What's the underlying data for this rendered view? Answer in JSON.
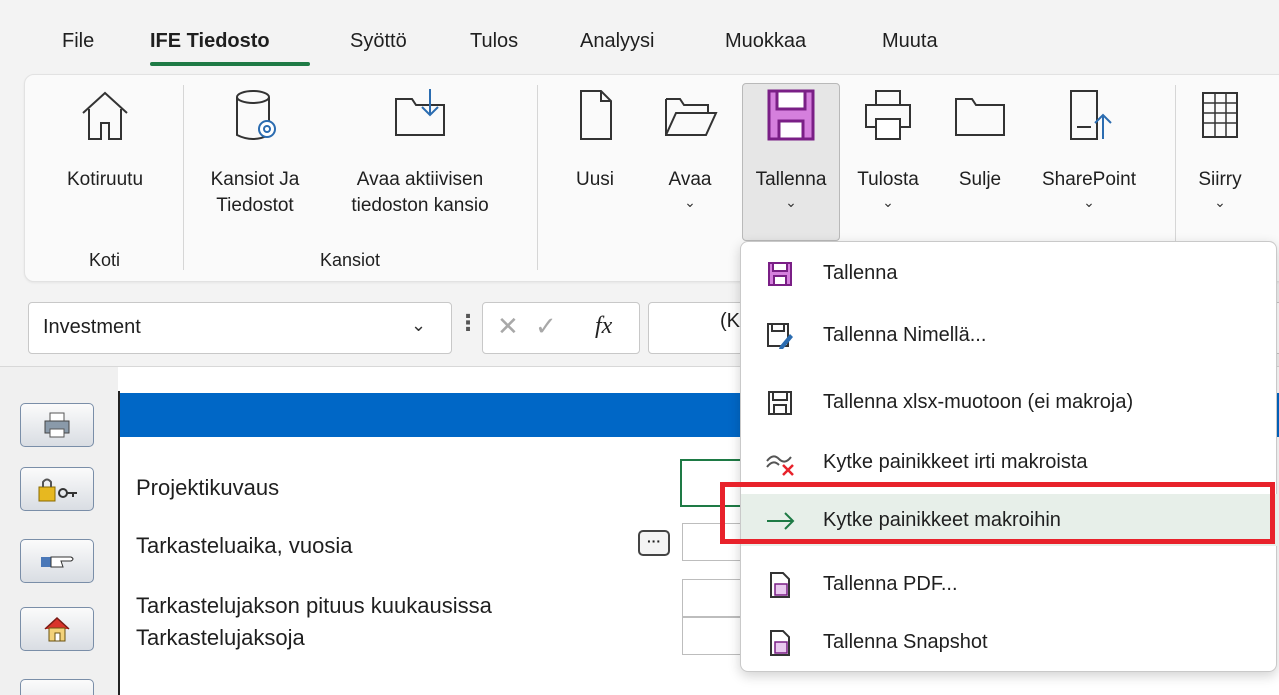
{
  "menubar": {
    "tabs": [
      "File",
      "IFE Tiedosto",
      "Syöttö",
      "Tulos",
      "Analyysi",
      "Muokkaa",
      "Muuta"
    ],
    "active_tab": "IFE Tiedosto"
  },
  "ribbon": {
    "koti_button": "Kotiruutu",
    "koti_group": "Koti",
    "kansiot_button_1": "Kansiot Ja",
    "kansiot_button_2": "Tiedostot",
    "avaa_kansio_1": "Avaa aktiivisen",
    "avaa_kansio_2": "tiedoston kansio",
    "kansiot_group": "Kansiot",
    "uusi": "Uusi",
    "avaa": "Avaa",
    "tallenna": "Tallenna",
    "tulosta": "Tulosta",
    "sulje": "Sulje",
    "sharepoint": "SharePoint",
    "siirry": "Siirry",
    "chevron": "⌄"
  },
  "formula_bar": {
    "name_box": "Investment",
    "dots": "⋮",
    "cancel": "✕",
    "enter": "✓",
    "fx": "fx"
  },
  "sheet": {
    "labels": {
      "projektikuvaus": "Projektikuvaus",
      "tarkasteluaika": "Tarkasteluaika, vuosia",
      "jakson_pituus": "Tarkastelujakson pituus kuukausissa",
      "jaksoja": "Tarkastelujaksoja",
      "kk": "(KK/VVVV)"
    },
    "dots_button": "···"
  },
  "dropdown": {
    "items": [
      {
        "label": "Tallenna",
        "icon": "save-icon"
      },
      {
        "label": "Tallenna Nimellä...",
        "icon": "save-as-icon"
      },
      {
        "label": "Tallenna xlsx-muotoon (ei makroja)",
        "icon": "save-xlsx-icon"
      },
      {
        "label": "Kytke painikkeet irti makroista",
        "icon": "unlink-icon"
      },
      {
        "label": "Kytke painikkeet makroihin",
        "icon": "arrow-right-icon"
      },
      {
        "label": "Tallenna PDF...",
        "icon": "pdf-icon"
      },
      {
        "label": "Tallenna Snapshot",
        "icon": "snapshot-icon"
      }
    ],
    "highlighted_item": "Kytke painikkeet makroihin"
  },
  "colors": {
    "accent_green": "#1e7a45",
    "save_purple": "#b43ec2",
    "highlight_red": "#e8222b",
    "sheet_blue": "#0067c6"
  }
}
